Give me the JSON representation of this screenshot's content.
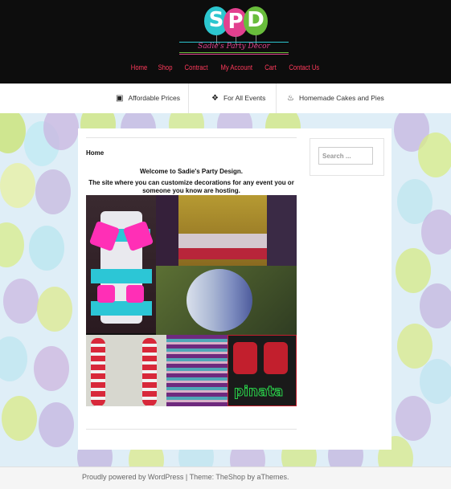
{
  "brand": {
    "letters": [
      "S",
      "P",
      "D"
    ],
    "tagline": "Sadie's Party Decor",
    "colors": {
      "s": "#2cc6cf",
      "p": "#e2408f",
      "d": "#69bd3c"
    }
  },
  "nav": {
    "items": [
      {
        "label": "Home"
      },
      {
        "label": "Shop"
      },
      {
        "label": "Contract"
      },
      {
        "label": "My Account"
      },
      {
        "label": "Cart"
      },
      {
        "label": "Contact Us"
      }
    ],
    "color": "#ff3a5b"
  },
  "features": [
    {
      "icon": "money-icon",
      "label": "Affordable Prices"
    },
    {
      "icon": "gift-icon",
      "label": "For All Events"
    },
    {
      "icon": "cake-icon",
      "label": "Homemade Cakes and Pies"
    }
  ],
  "page": {
    "breadcrumb": "Home",
    "welcome_line1": "Welcome to Sadie's Party Design.",
    "welcome_line2": "The site where you can customize decorations for any event you or someone you know are hosting.",
    "collage_caption": "pinata"
  },
  "sidebar": {
    "search_placeholder": "Search ..."
  },
  "footer": {
    "text": "Proudly powered by WordPress | Theme: TheShop by aThemes."
  }
}
